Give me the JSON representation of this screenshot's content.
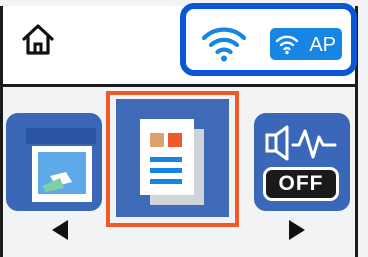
{
  "status_bar": {
    "home_icon": "home-icon",
    "wifi_icon": "wifi-signal-icon",
    "ap_badge": {
      "icon": "wifi-direct-icon",
      "label": "AP"
    },
    "connection_highlight_color": "#0a57d6"
  },
  "menu": {
    "selected_index": 1,
    "selection_color": "#ee5a2a",
    "tile_color": "#3a67b7",
    "items": [
      {
        "icon": "scan-to-computer-icon"
      },
      {
        "icon": "copy-document-icon"
      },
      {
        "icon": "sound-icon",
        "badge_label": "OFF"
      }
    ],
    "prev_icon": "arrow-left-icon",
    "next_icon": "arrow-right-icon"
  }
}
